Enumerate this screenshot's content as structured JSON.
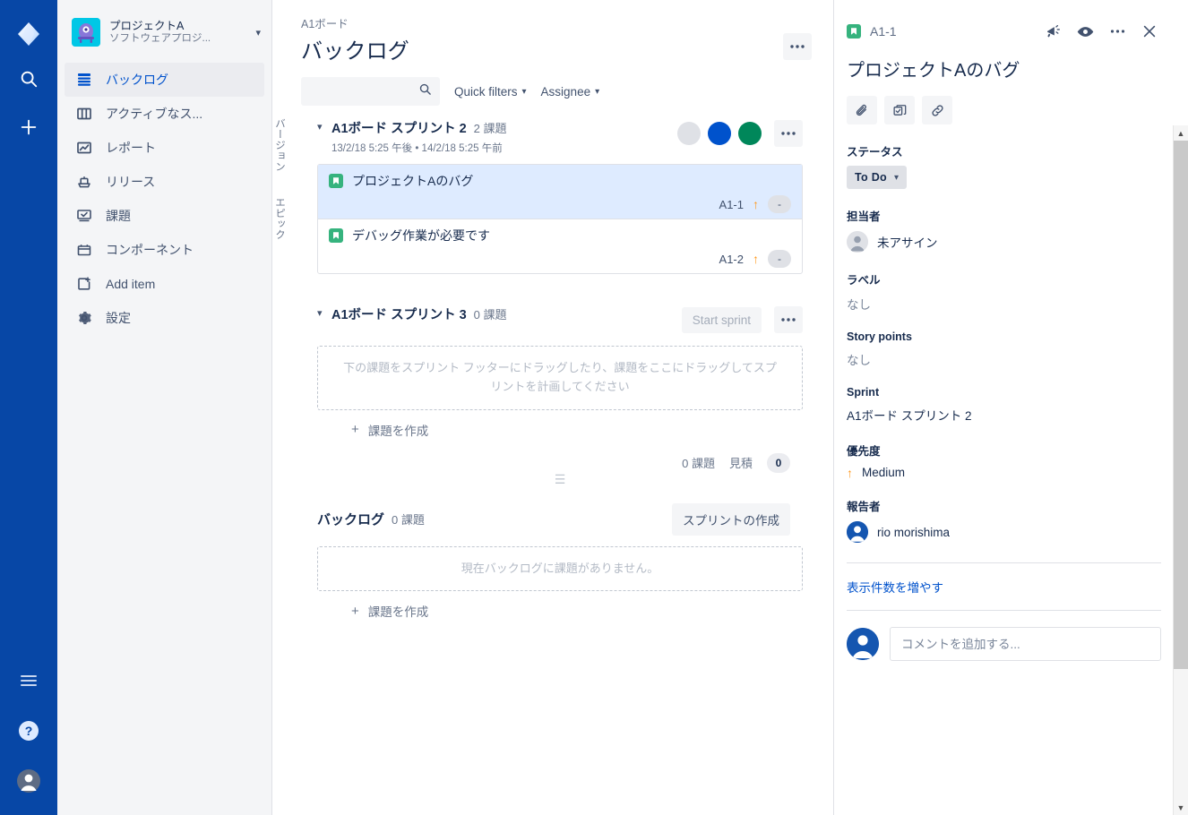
{
  "product_nav": {
    "logo_name": "jira-logo",
    "items": [
      {
        "name": "search-icon",
        "label": "Search"
      },
      {
        "name": "create-icon",
        "label": "Create"
      }
    ],
    "bottom_items": [
      {
        "name": "menu-icon",
        "label": "Menu"
      },
      {
        "name": "help-icon",
        "label": "Help"
      },
      {
        "name": "profile-icon",
        "label": "Profile"
      }
    ]
  },
  "sidebar": {
    "project": {
      "name": "プロジェクトA",
      "type": "ソフトウェアプロジ...",
      "avatar_color": "#00C7E6"
    },
    "items": [
      {
        "label": "バックログ",
        "icon": "backlog-icon",
        "active": true
      },
      {
        "label": "アクティブなス...",
        "icon": "board-columns-icon",
        "active": false
      },
      {
        "label": "レポート",
        "icon": "reports-chart-icon",
        "active": false
      },
      {
        "label": "リリース",
        "icon": "releases-ship-icon",
        "active": false
      },
      {
        "label": "課題",
        "icon": "issues-icon",
        "active": false
      },
      {
        "label": "コンポーネント",
        "icon": "components-icon",
        "active": false
      },
      {
        "label": "Add item",
        "icon": "add-item-icon",
        "active": false
      },
      {
        "label": "設定",
        "icon": "settings-gear-icon",
        "active": false
      }
    ]
  },
  "header": {
    "breadcrumb": "A1ボード",
    "title": "バックログ",
    "more_label": "•••"
  },
  "filters": {
    "search_placeholder": "",
    "search_value": "",
    "quick_filters_label": "Quick filters",
    "assignee_label": "Assignee"
  },
  "rail": {
    "versions_label": "バージョン",
    "epics_label": "エピック"
  },
  "sprints": [
    {
      "title": "A1ボード スプリント 2",
      "count_label": "2 課題",
      "dates": "13/2/18 5:25 午後 • 14/2/18 5:25 午前",
      "avatars": [
        "#DFE1E6",
        "#0052CC",
        "#00875A"
      ],
      "more_label": "•••",
      "issues": [
        {
          "summary": "プロジェクトAのバグ",
          "key": "A1-1",
          "priority_icon": "priority-medium-up-arrow",
          "estimate": "-",
          "type_icon": "story-icon",
          "selected": true
        },
        {
          "summary": "デバッグ作業が必要です",
          "key": "A1-2",
          "priority_icon": "priority-medium-up-arrow",
          "estimate": "-",
          "type_icon": "story-icon",
          "selected": false
        }
      ]
    },
    {
      "title": "A1ボード スプリント 3",
      "count_label": "0 課題",
      "start_button_label": "Start sprint",
      "more_label": "•••",
      "dropzone_text": "下の課題をスプリント フッターにドラッグしたり、課題をここにドラッグしてスプリントを計画してください",
      "create_issue_label": "課題を作成",
      "footer": {
        "count_label": "0 課題",
        "estimate_label": "見積",
        "estimate_value": "0"
      }
    }
  ],
  "backlog": {
    "title": "バックログ",
    "count_label": "0 課題",
    "create_sprint_label": "スプリントの作成",
    "empty_text": "現在バックログに課題がありません。",
    "create_issue_label": "課題を作成"
  },
  "detail": {
    "key": "A1-1",
    "type_icon": "story-icon",
    "title": "プロジェクトAのバグ",
    "actions": [
      {
        "name": "feedback-megaphone-icon"
      },
      {
        "name": "watch-eye-icon"
      },
      {
        "name": "more-icon"
      },
      {
        "name": "close-icon"
      }
    ],
    "quick_buttons": [
      {
        "name": "attach-paperclip-icon"
      },
      {
        "name": "child-issue-icon"
      },
      {
        "name": "link-issue-icon"
      }
    ],
    "status": {
      "label": "ステータス",
      "value": "To Do"
    },
    "fields": [
      {
        "label": "担当者",
        "value": "未アサイン",
        "icon": "avatar-placeholder-icon",
        "muted": false
      },
      {
        "label": "ラベル",
        "value": "なし",
        "icon": null,
        "muted": true
      },
      {
        "label": "Story points",
        "value": "なし",
        "icon": null,
        "muted": true
      },
      {
        "label": "Sprint",
        "value": "A1ボード スプリント 2",
        "icon": null,
        "muted": false
      },
      {
        "label": "優先度",
        "value": "Medium",
        "icon": "priority-medium-up-arrow",
        "muted": false
      },
      {
        "label": "報告者",
        "value": "rio morishima",
        "icon": "avatar-user-icon",
        "muted": false
      }
    ],
    "show_more_label": "表示件数を増やす",
    "comment_placeholder": "コメントを追加する..."
  },
  "colors": {
    "nav_blue": "#0747A6",
    "link_blue": "#0052CC",
    "green": "#00875A",
    "story_green": "#36B37E",
    "priority_orange": "#FF991F",
    "selected_row": "#DEEBFF",
    "grey_bg": "#F4F5F7"
  }
}
